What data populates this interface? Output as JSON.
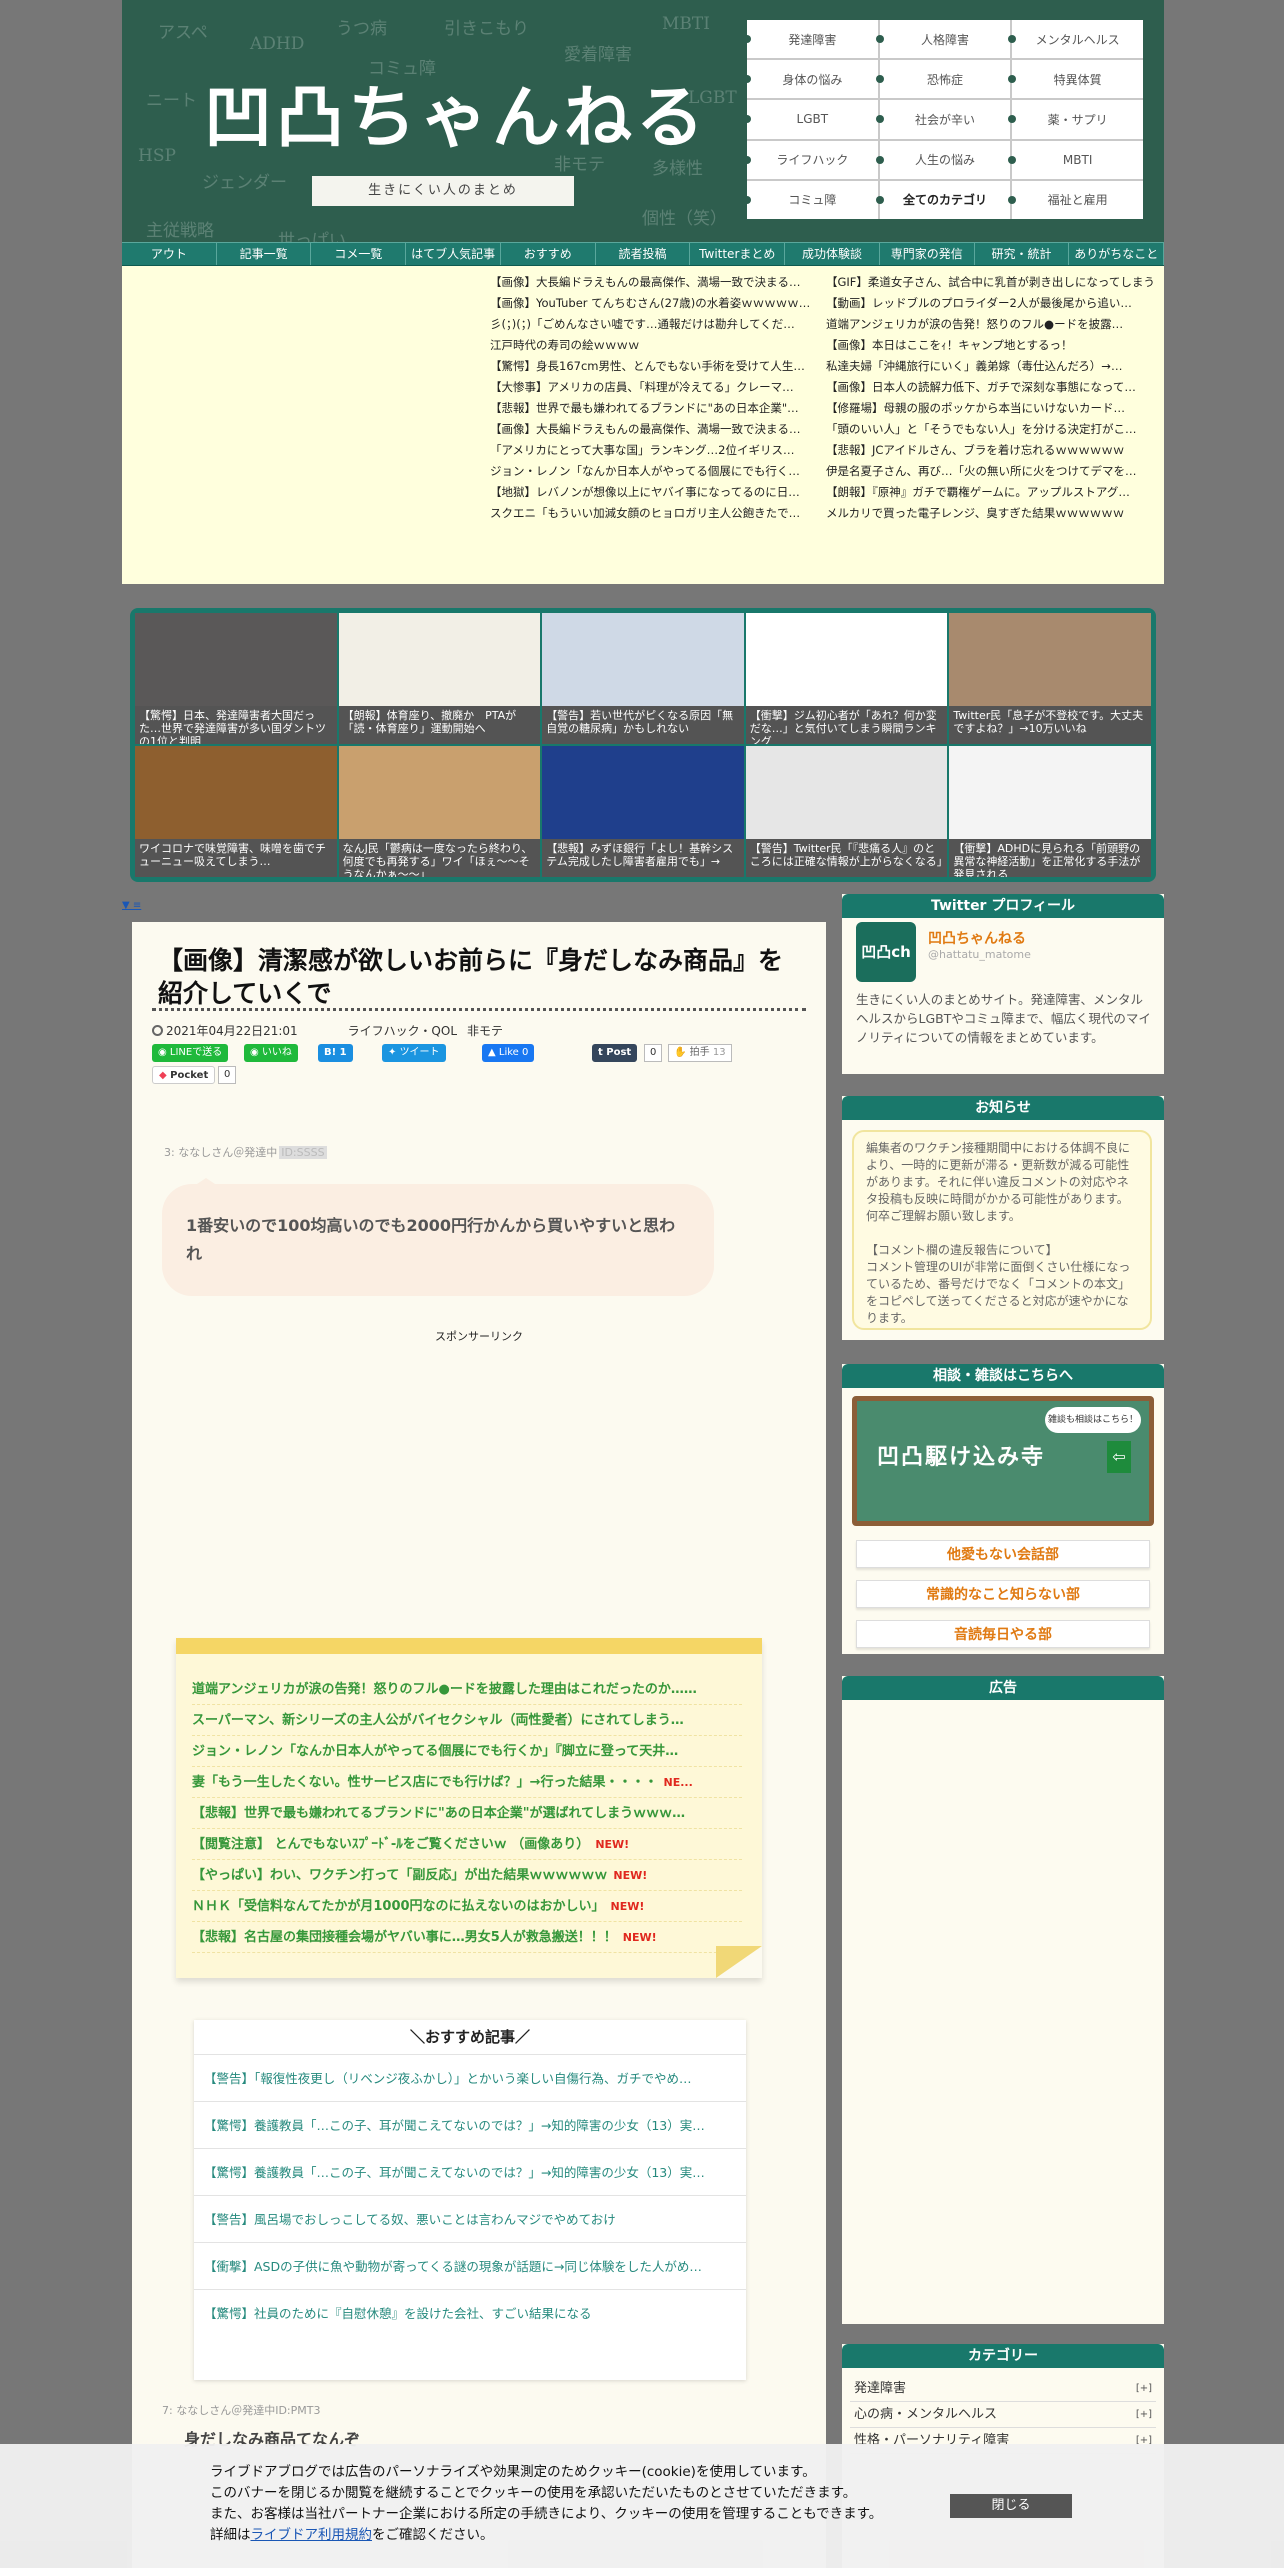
{
  "header": {
    "title": "凹凸ちゃんねる",
    "subtitle": "生きにくい人のまとめ",
    "board_words": [
      "アスペ",
      "ADHD",
      "うつ病",
      "引きこもり",
      "MBTI",
      "コミュ障",
      "愛着障害",
      "ニート",
      "LGBT",
      "HSP",
      "ジェンダー",
      "多様性",
      "非モテ",
      "主従戦略",
      "個性（笑）",
      "世っぱい"
    ],
    "categories": [
      "発達障害",
      "人格障害",
      "メンタルヘルス",
      "身体の悩み",
      "恐怖症",
      "特異体質",
      "LGBT",
      "社会が辛い",
      "薬・サプリ",
      "ライフハック",
      "人生の悩み",
      "MBTI",
      "コミュ障",
      "全てのカテゴリ",
      "福祉と雇用"
    ]
  },
  "nav": [
    "アウト",
    "記事一覧",
    "コメ一覧",
    "はてブ人気記事",
    "おすすめ",
    "読者投稿",
    "Twitterまとめ",
    "成功体験談",
    "専門家の発信",
    "研究・統計",
    "ありがちなこと"
  ],
  "rss": [
    "【画像】大長編ドラえもんの最高傑作、満場一致で決まる…",
    "【GIF】柔道女子さん、試合中に乳首が剥き出しになってしまう",
    "【画像】YouTuber てんちむさん(27歳)の水着姿ｗｗｗｗｗ…",
    "【動画】レッドブルのプロライダー2人が最後尾から追い…",
    "彡(；)(；)「ごめんなさい嘘です…通報だけは勘弁してくだ…",
    "道端アンジェリカが涙の告発！怒りのフル●ードを披露…",
    "江戸時代の寿司の絵ｗｗｗｗ",
    "【画像】本日はここをｨ！キャンプ地とするっ！",
    "【驚愕】身長167cm男性、とんでもない手術を受けて人生…",
    "私達夫婦「沖縄旅行にいく」義弟嫁（毒仕込んだろ）→…",
    "【大惨事】アメリカの店員、「料理が冷えてる」クレーマ…",
    "【画像】日本人の読解力低下、ガチで深刻な事態になって…",
    "【悲報】世界で最も嫌われてるブランドに\"あの日本企業\"…",
    "【修羅場】母親の服のポッケから本当にいけないカード…",
    "【画像】大長編ドラえもんの最高傑作、満場一致で決まる…",
    "「頭のいい人」と「そうでもない人」を分ける決定打がこ…",
    "「アメリカにとって大事な国」ランキング…2位イギリス…",
    "【悲報】JCアイドルさん、ブラを着け忘れるｗｗｗｗｗｗ",
    "ジョン・レノン「なんか日本人がやってる個展にでも行く…",
    "伊是名夏子さん、再び…「火の無い所に火をつけてデマを…",
    "【地獄】レバノンが想像以上にヤバイ事になってるのに日…",
    "【朗報】『原神』ガチで覇権ゲームに。アップルストアグ…",
    "スクエニ「もういい加減女顔のヒョロガリ主人公飽きたで…",
    "メルカリで買った電子レンジ、臭すぎた結果ｗｗｗｗｗｗ"
  ],
  "thumbs": [
    "【驚愕】日本、発達障害者大国だった…世界で発達障害が多い国ダントツの1位と判明",
    "【朗報】体育座り、撤廃か　PTAが「読・体育座り」運動開始へ",
    "【警告】若い世代がピくなる原因「無自覚の糖尿病」かもしれない",
    "【衝撃】ジム初心者が「あれ？何か変だな…」と気付いてしまう瞬間ランキング",
    "Twitter民「息子が不登校です。大丈夫ですよね？」→10万いいね",
    "ワイコロナで味覚障害、味噌を歯でチューニュー吸えてしまう…",
    "なんJ民「鬱病は一度なったら終わり、何度でも再発する」ワイ「ほぇ～～そうなんかぁ～～」",
    "【悲報】みずほ銀行「よし！基幹システム完成したし障害者雇用でも」→",
    "【警告】Twitter民「『悲痛る人』のところには正確な情報が上がらなくなる」",
    "【衝撃】ADHDに見られる「前頭野の異常な神経活動」を正常化する手法が発見される"
  ],
  "small_link": "▼ ≡",
  "article": {
    "title": "【画像】清潔感が欲しいお前らに『身だしなみ商品』を紹介していくで",
    "date": "2021年04月22日21:01",
    "tags": [
      "ライフハック・QOL",
      "非モテ"
    ],
    "share": {
      "line": "LINEで送る",
      "iine": "いいね",
      "hatena": "B! 1",
      "tweet": "ツイート",
      "fb": "Like 0",
      "tumblr": "Post",
      "tumblr_count": "0",
      "clap": "拍手",
      "clap_count": "13",
      "pocket": "Pocket",
      "pocket_count": "0"
    },
    "comment3_head": "3: ななしさん＠発達中",
    "comment3_id": "ID:SSSS",
    "comment3_text": "1番安いので100均高いのでも2000円行かんから買いやすいと思われ",
    "sponsor": "スポンサーリンク",
    "sticky": [
      {
        "text": "道端アンジェリカが涙の告発！怒りのフル●ードを披露した理由はこれだったのか……",
        "new": ""
      },
      {
        "text": "スーパーマン、新シリーズの主人公がバイセクシャル（両性愛者）にされてしまう…",
        "new": ""
      },
      {
        "text": "ジョン・レノン「なんか日本人がやってる個展にでも行くか」『脚立に登って天井…",
        "new": ""
      },
      {
        "text": "妻「もう一生したくない。性サービス店にでも行けば？」→行った結果・・・・",
        "new": "NE..."
      },
      {
        "text": "【悲報】世界で最も嫌われてるブランドに\"あの日本企業\"が選ばれてしまうｗｗｗ…",
        "new": ""
      },
      {
        "text": "【閲覧注意】 とんでもないｽﾌﾟｰﾄﾞ-ﾙをご覧くださいｗ （画像あり）",
        "new": "NEW!"
      },
      {
        "text": "【やっぱい】わい、ワクチン打って「副反応」が出た結果ｗｗｗｗｗｗ",
        "new": "NEW!"
      },
      {
        "text": "ＮＨＫ「受信料なんてたかが月1000円なのに払えないのはおかしい」",
        "new": "NEW!"
      },
      {
        "text": "【悲報】名古屋の集団接種会場がヤバい事に…男女5人が救急搬送！！！",
        "new": "NEW!"
      }
    ],
    "rec_title": "＼おすすめ記事／",
    "rec": [
      "【警告】「報復性夜更し（リベンジ夜ふかし）」とかいう楽しい自傷行為、ガチでやめ…",
      "【驚愕】養護教員「…この子、耳が聞こえてないのでは？」→知的障害の少女（13）実…",
      "【驚愕】養護教員「…この子、耳が聞こえてないのでは？」→知的障害の少女（13）実…",
      "【警告】風呂場でおしっこしてる奴、悪いことは言わんマジでやめておけ",
      "【衝撃】ASDの子供に魚や動物が寄ってくる謎の現象が話題に→同じ体験をした人がめ…",
      "【驚愕】社員のために『自慰休憩』を設けた会社、すごい結果になる"
    ],
    "comment7_head": "7: ななしさん＠発達中ID:PMT3",
    "comment7_text": "身だしなみ商品てなんぞ"
  },
  "sidebar": {
    "twitter_head": "Twitter プロフィール",
    "twitter_avatar": "凹凸ch",
    "twitter_name": "凹凸ちゃんねる",
    "twitter_handle": "@hattatu_matome",
    "twitter_desc": "生きにくい人のまとめサイト。発達障害、メンタルヘルスからLGBTやコミュ障まで、幅広く現代のマイノリティについての情報をまとめています。",
    "notice_head": "お知らせ",
    "notice_p1": "編集者のワクチン接種期間中における体調不良により、一時的に更新が滞る・更新数が減る可能性があります。それに伴い違反コメントの対応やネタ投稿も反映に時間がかかる可能性があります。何卒ご理解お願い致します。",
    "notice_p2": "【コメント欄の違反報告について】\nコメント管理のUIが非常に面倒くさい仕様になっているため、番号だけでなく「コメントの本文」をコピペして送ってくださると対応が速やかになります。",
    "soudan_head": "相談・雑談はこちらへ",
    "soudan_banner": "凹凸駆け込み寺",
    "soudan_balloon": "雑談も相談はこちら！",
    "soudan_links": [
      "他愛もない会話部",
      "常識的なこと知らない部",
      "音読毎日やる部"
    ],
    "ad_head": "広告",
    "cat_head": "カテゴリー",
    "cat_items": [
      "発達障害",
      "心の病・メンタルヘルス",
      "性格・パーソナリティ障害"
    ],
    "cat_plus": "[+]"
  },
  "cookie": {
    "line1": "ライブドアブログでは広告のパーソナライズや効果測定のためクッキー(cookie)を使用しています。",
    "line2": "このバナーを閉じるか閲覧を継続することでクッキーの使用を承認いただいたものとさせていただきます。",
    "line3": "また、お客様は当社パートナー企業における所定の手続きにより、クッキーの使用を管理することもできます。",
    "line4_pre": "詳細は",
    "line4_link": "ライブドア利用規約",
    "line4_post": "をご確認ください。",
    "close": "閉じる"
  }
}
